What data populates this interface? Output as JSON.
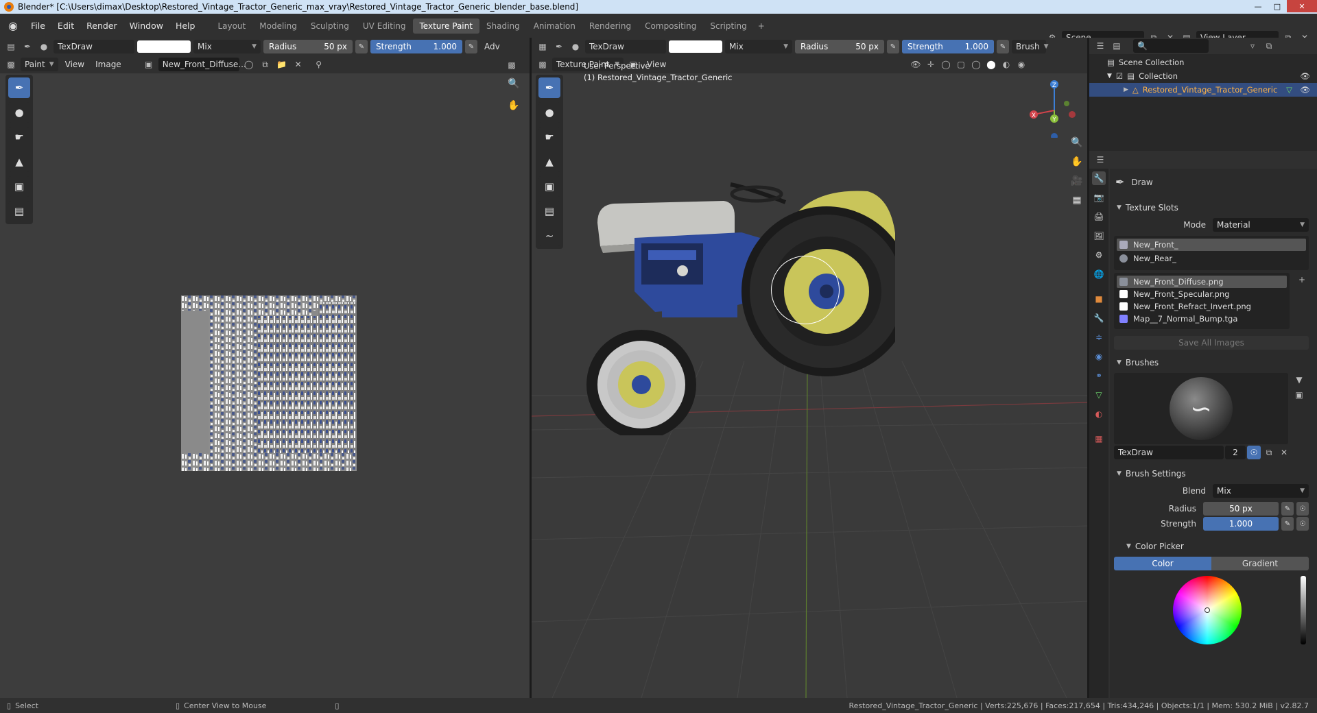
{
  "window": {
    "title": "Blender* [C:\\Users\\dimax\\Desktop\\Restored_Vintage_Tractor_Generic_max_vray\\Restored_Vintage_Tractor_Generic_blender_base.blend]"
  },
  "menu": [
    "File",
    "Edit",
    "Render",
    "Window",
    "Help"
  ],
  "workspaces": [
    "Layout",
    "Modeling",
    "Sculpting",
    "UV Editing",
    "Texture Paint",
    "Shading",
    "Animation",
    "Rendering",
    "Compositing",
    "Scripting"
  ],
  "active_workspace": "Texture Paint",
  "scene": {
    "name": "Scene",
    "view_layer": "View Layer"
  },
  "image_editor": {
    "brush": "TexDraw",
    "blend": "Mix",
    "radius_label": "Radius",
    "radius_value": "50 px",
    "strength_label": "Strength",
    "strength_value": "1.000",
    "adv": "Adv",
    "mode": "Paint",
    "view": "View",
    "image": "Image",
    "image_name": "New_Front_Diffuse..."
  },
  "viewport": {
    "brush": "TexDraw",
    "blend": "Mix",
    "radius_label": "Radius",
    "radius_value": "50 px",
    "strength_label": "Strength",
    "strength_value": "1.000",
    "brush_menu": "Brush",
    "mode": "Texture Paint",
    "view": "View",
    "perspective": "User Perspective",
    "object": "(1) Restored_Vintage_Tractor_Generic",
    "gizmo_axes": [
      "X",
      "Y",
      "Z"
    ]
  },
  "outliner": {
    "scene_collection": "Scene Collection",
    "collection": "Collection",
    "object": "Restored_Vintage_Tractor_Generic"
  },
  "properties": {
    "tool_name": "Draw",
    "texture_slots": {
      "title": "Texture Slots",
      "mode_label": "Mode",
      "mode_value": "Material",
      "materials": [
        "New_Front_",
        "New_Rear_"
      ],
      "images": [
        {
          "name": "New_Front_Diffuse.png",
          "color": "#8a8f9a"
        },
        {
          "name": "New_Front_Specular.png",
          "color": "#ffffff"
        },
        {
          "name": "New_Front_Refract_Invert.png",
          "color": "#ffffff"
        },
        {
          "name": "Map__7_Normal_Bump.tga",
          "color": "#8080ff"
        }
      ],
      "save_all": "Save All Images"
    },
    "brushes": {
      "title": "Brushes",
      "name": "TexDraw",
      "users": "2"
    },
    "brush_settings": {
      "title": "Brush Settings",
      "blend_label": "Blend",
      "blend_value": "Mix",
      "radius_label": "Radius",
      "radius_value": "50 px",
      "strength_label": "Strength",
      "strength_value": "1.000"
    },
    "color_picker": {
      "title": "Color Picker",
      "tabs": [
        "Color",
        "Gradient"
      ],
      "active_tab": "Color"
    }
  },
  "statusbar": {
    "select": "Select",
    "center": "Center View to Mouse",
    "stats": "Restored_Vintage_Tractor_Generic | Verts:225,676 | Faces:217,654 | Tris:434,246 | Objects:1/1 | Mem: 530.2 MiB | v2.82.7"
  },
  "colors": {
    "accent": "#4772b3",
    "tractor_blue": "#2e4a9c",
    "tractor_yellow": "#c9c55a",
    "x_axis": "#d2434b",
    "y_axis": "#8cc03a",
    "z_axis": "#3c7fd6"
  }
}
